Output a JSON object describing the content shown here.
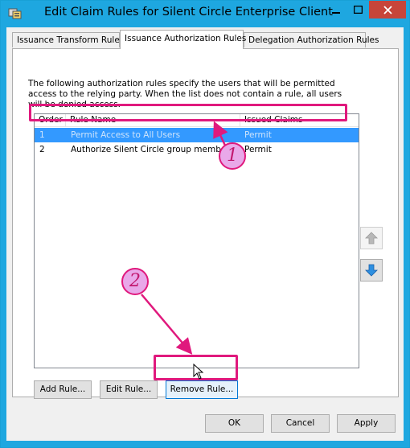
{
  "window": {
    "title": "Edit Claim Rules for Silent Circle Enterprise Client",
    "controls": {
      "minimize": "—",
      "maximize": "□",
      "close": "✕"
    }
  },
  "tabs": [
    {
      "label": "Issuance Transform Rules"
    },
    {
      "label": "Issuance Authorization Rules",
      "active": true
    },
    {
      "label": "Delegation Authorization Rules"
    }
  ],
  "panel": {
    "description": "The following authorization rules specify the users that will be permitted access to the relying party. When the list does not contain a rule, all users will be denied access.",
    "columns": {
      "order": "Order",
      "rule_name": "Rule Name",
      "issued_claims": "Issued Claims"
    },
    "rows": [
      {
        "order": "1",
        "rule_name": "Permit Access to All Users",
        "issued_claims": "Permit",
        "selected": true
      },
      {
        "order": "2",
        "rule_name": "Authorize Silent Circle group members",
        "issued_claims": "Permit",
        "selected": false
      }
    ],
    "buttons": {
      "add": "Add Rule...",
      "edit": "Edit Rule...",
      "remove": "Remove Rule..."
    }
  },
  "footer": {
    "ok": "OK",
    "cancel": "Cancel",
    "apply": "Apply"
  },
  "annotations": {
    "badge_1": "1",
    "badge_2": "2",
    "color": "#e0197d",
    "badge_fill": "#e9a8e9"
  },
  "colors": {
    "title_bar": "#1ea7e0",
    "selection": "#3399ff",
    "close_button": "#c7453a"
  }
}
